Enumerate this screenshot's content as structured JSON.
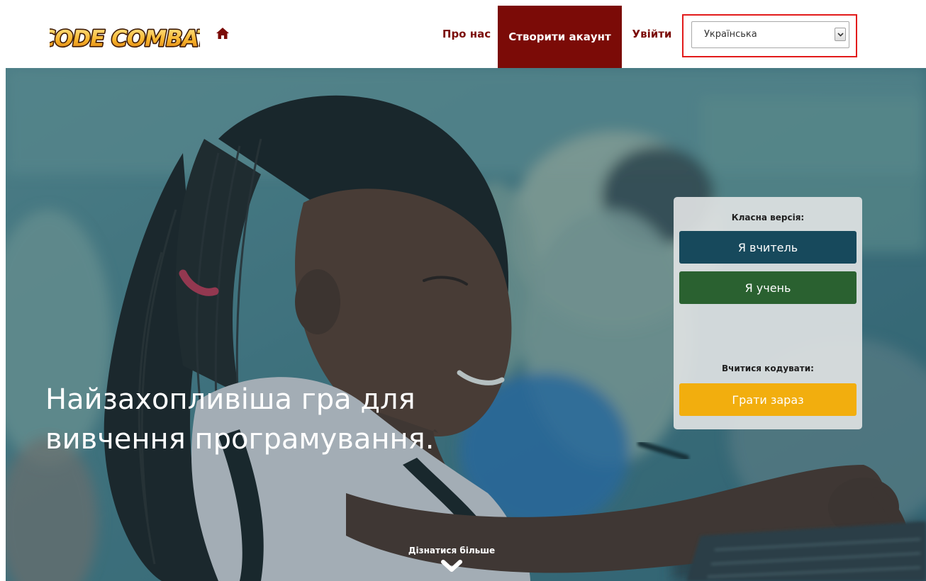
{
  "header": {
    "logo_text": "CODE COMBAT",
    "home_icon": "home-icon",
    "nav": {
      "about": "Про нас",
      "create_account": "Створити акаунт",
      "login": "Увійти"
    },
    "language": {
      "selected": "Українська"
    }
  },
  "hero": {
    "headline_line1": "Найзахопливіша гра для",
    "headline_line2": "вивчення програмування.",
    "learn_more": "Дізнатися більше",
    "panel": {
      "classroom_heading": "Класна версія:",
      "teacher_button": "Я вчитель",
      "student_button": "Я учень",
      "learn_heading": "Вчитися кодувати:",
      "play_button": "Грати зараз"
    }
  },
  "colors": {
    "brand_red": "#7b0b07",
    "highlight_border": "#e21b1b",
    "teacher_blue": "#17495c",
    "student_green": "#2a6130",
    "play_gold": "#f2ae0e"
  }
}
